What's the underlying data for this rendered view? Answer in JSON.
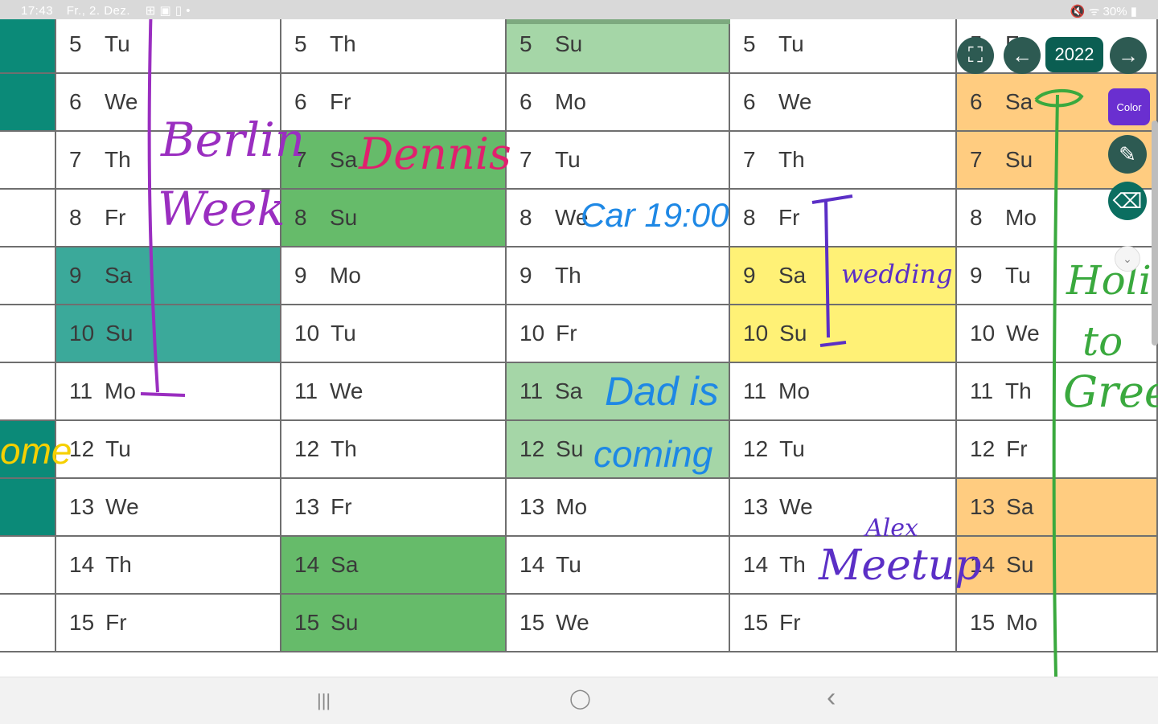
{
  "status_bar": {
    "time": "17:43",
    "date": "Fr., 2. Dez.",
    "icons": "⊞ ▣ ▯ •",
    "right": "🔇 ᯤ 30% ▮"
  },
  "colors": {
    "teal": "#3ba99a",
    "dark_teal": "#0b8a78",
    "light_green": "#a5d6a7",
    "green": "#66bb6a",
    "yellow": "#fff176",
    "orange": "#ffcc80",
    "ink_purple": "#9a2ec0",
    "ink_pink": "#e0206e",
    "ink_blue": "#1e88e5",
    "ink_violet": "#5b2fc6",
    "ink_green": "#3aa93e",
    "ink_yellow": "#f6d000"
  },
  "columns": [
    {
      "cells": [
        {
          "day": "",
          "weekday": "",
          "color": "#0b8a78"
        },
        {
          "day": "",
          "weekday": "",
          "color": "#0b8a78"
        },
        {
          "day": "",
          "weekday": "",
          "color": "#ffffff"
        },
        {
          "day": "",
          "weekday": "",
          "color": "#ffffff"
        },
        {
          "day": "",
          "weekday": "",
          "color": "#ffffff"
        },
        {
          "day": "",
          "weekday": "",
          "color": "#ffffff"
        },
        {
          "day": "",
          "weekday": "",
          "color": "#ffffff"
        },
        {
          "day": "",
          "weekday": "",
          "color": "#0b8a78"
        },
        {
          "day": "",
          "weekday": "",
          "color": "#0b8a78"
        },
        {
          "day": "",
          "weekday": "",
          "color": "#ffffff"
        },
        {
          "day": "",
          "weekday": "",
          "color": "#ffffff"
        }
      ]
    },
    {
      "cells": [
        {
          "day": "5",
          "weekday": "Tu",
          "color": "#ffffff"
        },
        {
          "day": "6",
          "weekday": "We",
          "color": "#ffffff"
        },
        {
          "day": "7",
          "weekday": "Th",
          "color": "#ffffff"
        },
        {
          "day": "8",
          "weekday": "Fr",
          "color": "#ffffff"
        },
        {
          "day": "9",
          "weekday": "Sa",
          "color": "#3ba99a"
        },
        {
          "day": "10",
          "weekday": "Su",
          "color": "#3ba99a"
        },
        {
          "day": "11",
          "weekday": "Mo",
          "color": "#ffffff"
        },
        {
          "day": "12",
          "weekday": "Tu",
          "color": "#ffffff"
        },
        {
          "day": "13",
          "weekday": "We",
          "color": "#ffffff"
        },
        {
          "day": "14",
          "weekday": "Th",
          "color": "#ffffff"
        },
        {
          "day": "15",
          "weekday": "Fr",
          "color": "#ffffff"
        }
      ]
    },
    {
      "cells": [
        {
          "day": "5",
          "weekday": "Th",
          "color": "#ffffff"
        },
        {
          "day": "6",
          "weekday": "Fr",
          "color": "#ffffff"
        },
        {
          "day": "7",
          "weekday": "Sa",
          "color": "#66bb6a"
        },
        {
          "day": "8",
          "weekday": "Su",
          "color": "#66bb6a"
        },
        {
          "day": "9",
          "weekday": "Mo",
          "color": "#ffffff"
        },
        {
          "day": "10",
          "weekday": "Tu",
          "color": "#ffffff"
        },
        {
          "day": "11",
          "weekday": "We",
          "color": "#ffffff"
        },
        {
          "day": "12",
          "weekday": "Th",
          "color": "#ffffff"
        },
        {
          "day": "13",
          "weekday": "Fr",
          "color": "#ffffff"
        },
        {
          "day": "14",
          "weekday": "Sa",
          "color": "#66bb6a"
        },
        {
          "day": "15",
          "weekday": "Su",
          "color": "#66bb6a"
        }
      ]
    },
    {
      "cells": [
        {
          "day": "5",
          "weekday": "Su",
          "color": "#a5d6a7"
        },
        {
          "day": "6",
          "weekday": "Mo",
          "color": "#ffffff"
        },
        {
          "day": "7",
          "weekday": "Tu",
          "color": "#ffffff"
        },
        {
          "day": "8",
          "weekday": "We",
          "color": "#ffffff"
        },
        {
          "day": "9",
          "weekday": "Th",
          "color": "#ffffff"
        },
        {
          "day": "10",
          "weekday": "Fr",
          "color": "#ffffff"
        },
        {
          "day": "11",
          "weekday": "Sa",
          "color": "#a5d6a7"
        },
        {
          "day": "12",
          "weekday": "Su",
          "color": "#a5d6a7"
        },
        {
          "day": "13",
          "weekday": "Mo",
          "color": "#ffffff"
        },
        {
          "day": "14",
          "weekday": "Tu",
          "color": "#ffffff"
        },
        {
          "day": "15",
          "weekday": "We",
          "color": "#ffffff"
        }
      ]
    },
    {
      "cells": [
        {
          "day": "5",
          "weekday": "Tu",
          "color": "#ffffff"
        },
        {
          "day": "6",
          "weekday": "We",
          "color": "#ffffff"
        },
        {
          "day": "7",
          "weekday": "Th",
          "color": "#ffffff"
        },
        {
          "day": "8",
          "weekday": "Fr",
          "color": "#ffffff"
        },
        {
          "day": "9",
          "weekday": "Sa",
          "color": "#fff176"
        },
        {
          "day": "10",
          "weekday": "Su",
          "color": "#fff176"
        },
        {
          "day": "11",
          "weekday": "Mo",
          "color": "#ffffff"
        },
        {
          "day": "12",
          "weekday": "Tu",
          "color": "#ffffff"
        },
        {
          "day": "13",
          "weekday": "We",
          "color": "#ffffff"
        },
        {
          "day": "14",
          "weekday": "Th",
          "color": "#ffffff"
        },
        {
          "day": "15",
          "weekday": "Fr",
          "color": "#ffffff"
        }
      ]
    },
    {
      "cells": [
        {
          "day": "5",
          "weekday": "Fr",
          "color": "#ffffff"
        },
        {
          "day": "6",
          "weekday": "Sa",
          "color": "#ffcc80"
        },
        {
          "day": "7",
          "weekday": "Su",
          "color": "#ffcc80"
        },
        {
          "day": "8",
          "weekday": "Mo",
          "color": "#ffffff"
        },
        {
          "day": "9",
          "weekday": "Tu",
          "color": "#ffffff"
        },
        {
          "day": "10",
          "weekday": "We",
          "color": "#ffffff"
        },
        {
          "day": "11",
          "weekday": "Th",
          "color": "#ffffff"
        },
        {
          "day": "12",
          "weekday": "Fr",
          "color": "#ffffff"
        },
        {
          "day": "13",
          "weekday": "Sa",
          "color": "#ffcc80"
        },
        {
          "day": "14",
          "weekday": "Su",
          "color": "#ffcc80"
        },
        {
          "day": "15",
          "weekday": "Mo",
          "color": "#ffffff"
        }
      ]
    }
  ],
  "toolbar": {
    "fullscreen_icon": "fullscreen-icon",
    "fullscreen_glyph": "⛶",
    "prev_glyph": "←",
    "next_glyph": "→",
    "year": "2022",
    "color_label": "Color",
    "pen_glyph": "✎",
    "eraser_glyph": "⌫",
    "dropdown_glyph": "⌄"
  },
  "annotations": {
    "berlin": "Berlin",
    "week": "Week",
    "dennis": "Dennis",
    "car": "Car 19:00",
    "wedding": "wedding",
    "dad_is": "Dad is",
    "coming": "coming",
    "alex": "Alex",
    "meetup": "Meetup",
    "holiday": "Holid",
    "to": "to",
    "greece": "Greec",
    "home_fragment": "ome"
  },
  "nav_bar": {
    "recents": "|||",
    "home": "◯",
    "back": "‹"
  }
}
